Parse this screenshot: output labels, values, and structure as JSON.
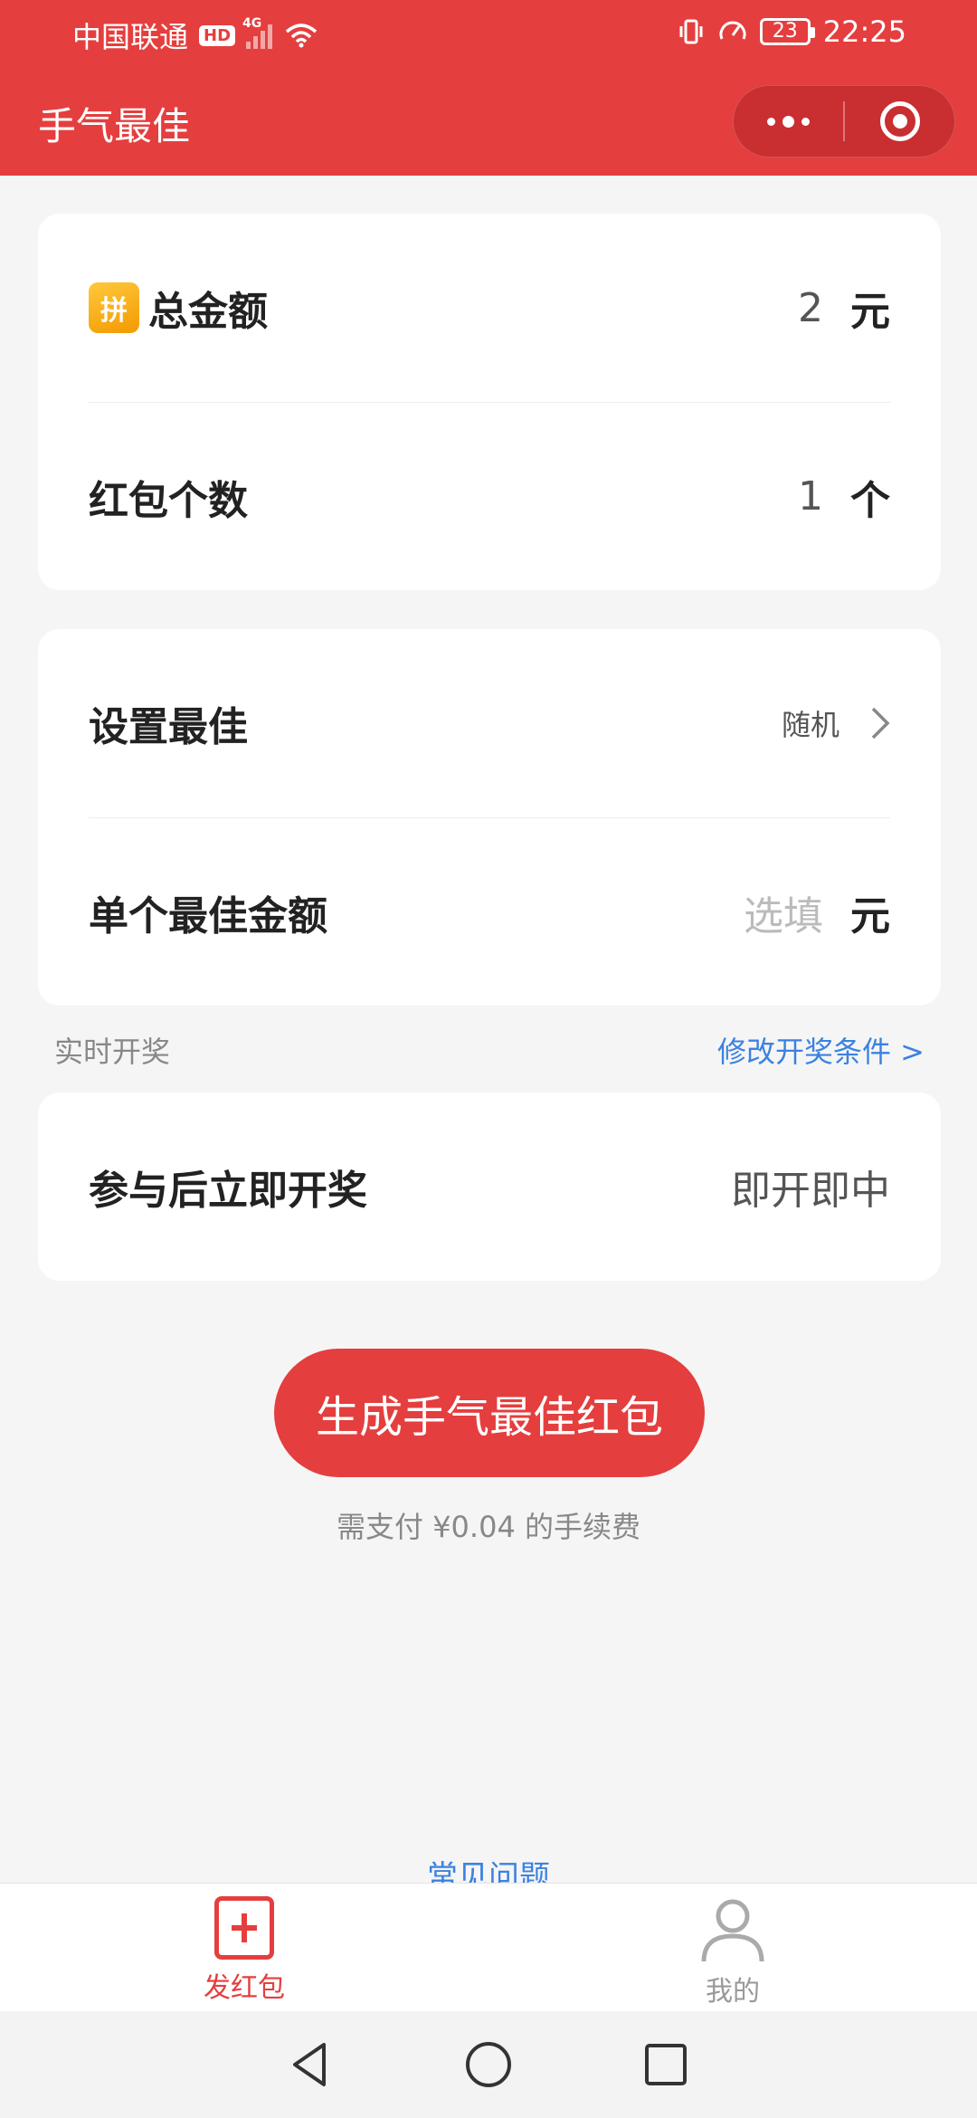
{
  "status_bar": {
    "carrier": "中国联通",
    "hd": "HD",
    "network": "4G",
    "battery": "23",
    "time": "22:25"
  },
  "nav": {
    "title": "手气最佳"
  },
  "card1": {
    "total": {
      "icon_text": "拼",
      "label": "总金额",
      "value": "2",
      "unit": "元"
    },
    "count": {
      "label": "红包个数",
      "value": "1",
      "unit": "个"
    }
  },
  "card2": {
    "best": {
      "label": "设置最佳",
      "value": "随机"
    },
    "best_amount": {
      "label": "单个最佳金额",
      "placeholder": "选填",
      "unit": "元"
    }
  },
  "section": {
    "left": "实时开奖",
    "right": "修改开奖条件 >"
  },
  "card3": {
    "label": "参与后立即开奖",
    "value": "即开即中"
  },
  "generate_button": "生成手气最佳红包",
  "fee_text": "需支付 ¥0.04 的手续费",
  "faq": "常见问题",
  "tabs": [
    {
      "label": "发红包",
      "icon": "add-box-icon"
    },
    {
      "label": "我的",
      "icon": "person-icon"
    }
  ],
  "colors": {
    "brand": "#e53e3e",
    "link": "#3b82e0"
  }
}
